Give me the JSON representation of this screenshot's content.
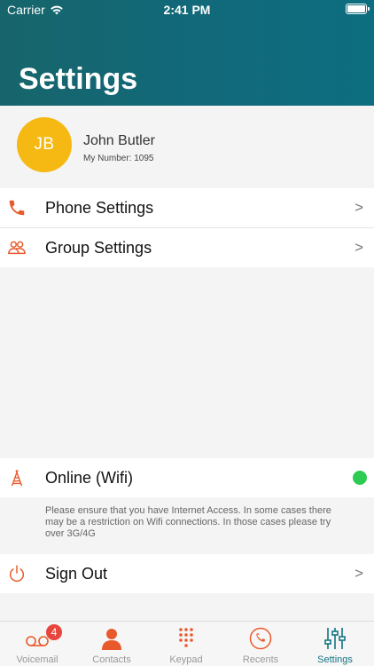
{
  "status_bar": {
    "carrier": "Carrier",
    "time": "2:41 PM"
  },
  "page": {
    "title": "Settings"
  },
  "profile": {
    "initials": "JB",
    "name": "John Butler",
    "number": "My Number: 1095"
  },
  "menu": {
    "phone_settings": "Phone Settings",
    "group_settings": "Group Settings",
    "online_status": "Online (Wifi)",
    "online_note": "Please ensure that you have Internet Access. In some cases there may be a restriction on Wifi connections. In those cases please try over 3G/4G",
    "sign_out": "Sign Out",
    "chevron": ">"
  },
  "tabs": {
    "voicemail": {
      "label": "Voicemail",
      "badge": "4"
    },
    "contacts": {
      "label": "Contacts"
    },
    "keypad": {
      "label": "Keypad"
    },
    "recents": {
      "label": "Recents"
    },
    "settings": {
      "label": "Settings"
    }
  },
  "colors": {
    "header": "#11697a",
    "accent_orange": "#e85a2c",
    "avatar": "#f6b913",
    "online": "#2ecb52",
    "active_tab": "#137484"
  },
  "icons": {
    "phone_settings": "phone-icon",
    "group_settings": "group-icon",
    "online": "antenna-icon",
    "sign_out": "power-icon"
  }
}
